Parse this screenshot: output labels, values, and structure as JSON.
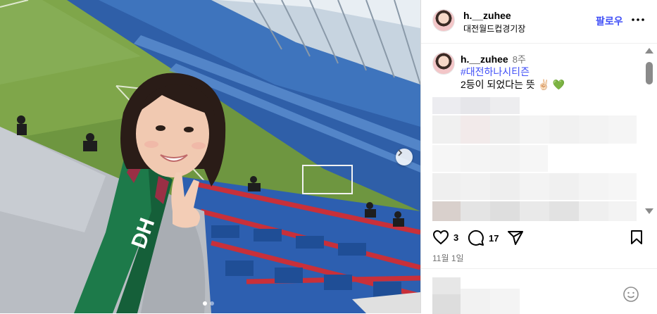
{
  "post": {
    "username": "h.__zuhee",
    "location": "대전월드컵경기장",
    "follow_label": "팔로우",
    "caption": {
      "username": "h.__zuhee",
      "time": "8주",
      "hashtag": "#대전하나시티즌",
      "text": "2등이 되었다는 뜻 ✌🏻 💚"
    },
    "likes": "3",
    "comments": "17",
    "date": "11월 1일"
  },
  "icons": {
    "more": "more-horizontal-icon",
    "like": "heart-icon",
    "comment": "comment-icon",
    "share": "share-icon",
    "save": "bookmark-icon",
    "emoji": "emoji-icon",
    "next": "chevron-right-icon"
  },
  "colors": {
    "link": "#4150f7",
    "muted": "#737373",
    "border": "#dbdbdb"
  }
}
